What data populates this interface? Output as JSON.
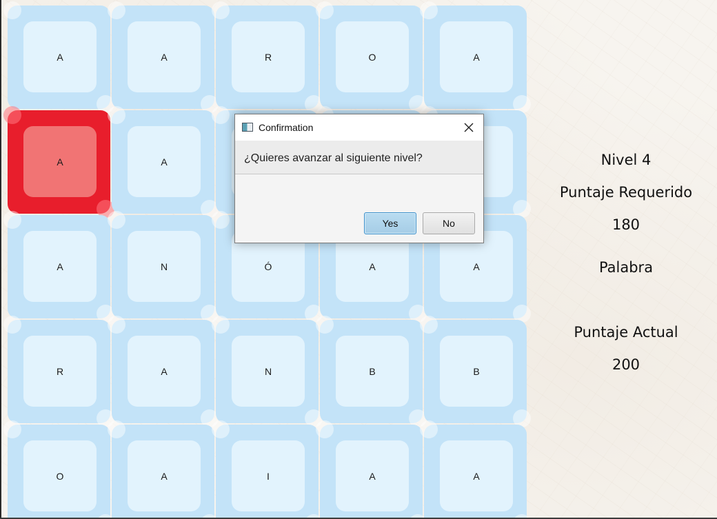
{
  "board": {
    "rows": [
      [
        "A",
        "A",
        "R",
        "O",
        "A"
      ],
      [
        "A",
        "A",
        "",
        "",
        ""
      ],
      [
        "A",
        "N",
        "Ó",
        "A",
        "A"
      ],
      [
        "R",
        "A",
        "N",
        "B",
        "B"
      ],
      [
        "O",
        "A",
        "I",
        "A",
        "A"
      ]
    ],
    "selected_cells": [
      [
        1,
        0
      ]
    ],
    "tile_color": "#c3e3f8",
    "tile_inner_color": "#e2f3fd",
    "selected_color": "#e81e2c",
    "selected_inner_color": "#f17474"
  },
  "side_panel": {
    "level_label": "Nivel 4",
    "required_score_label": "Puntaje Requerido",
    "required_score_value": "180",
    "word_label": "Palabra",
    "word_value": "",
    "current_score_label": "Puntaje Actual",
    "current_score_value": "200"
  },
  "dialog": {
    "title": "Confirmation",
    "message": "¿Quieres avanzar al siguiente nivel?",
    "yes_label": "Yes",
    "no_label": "No",
    "accent_color": "#3c8fc9"
  }
}
